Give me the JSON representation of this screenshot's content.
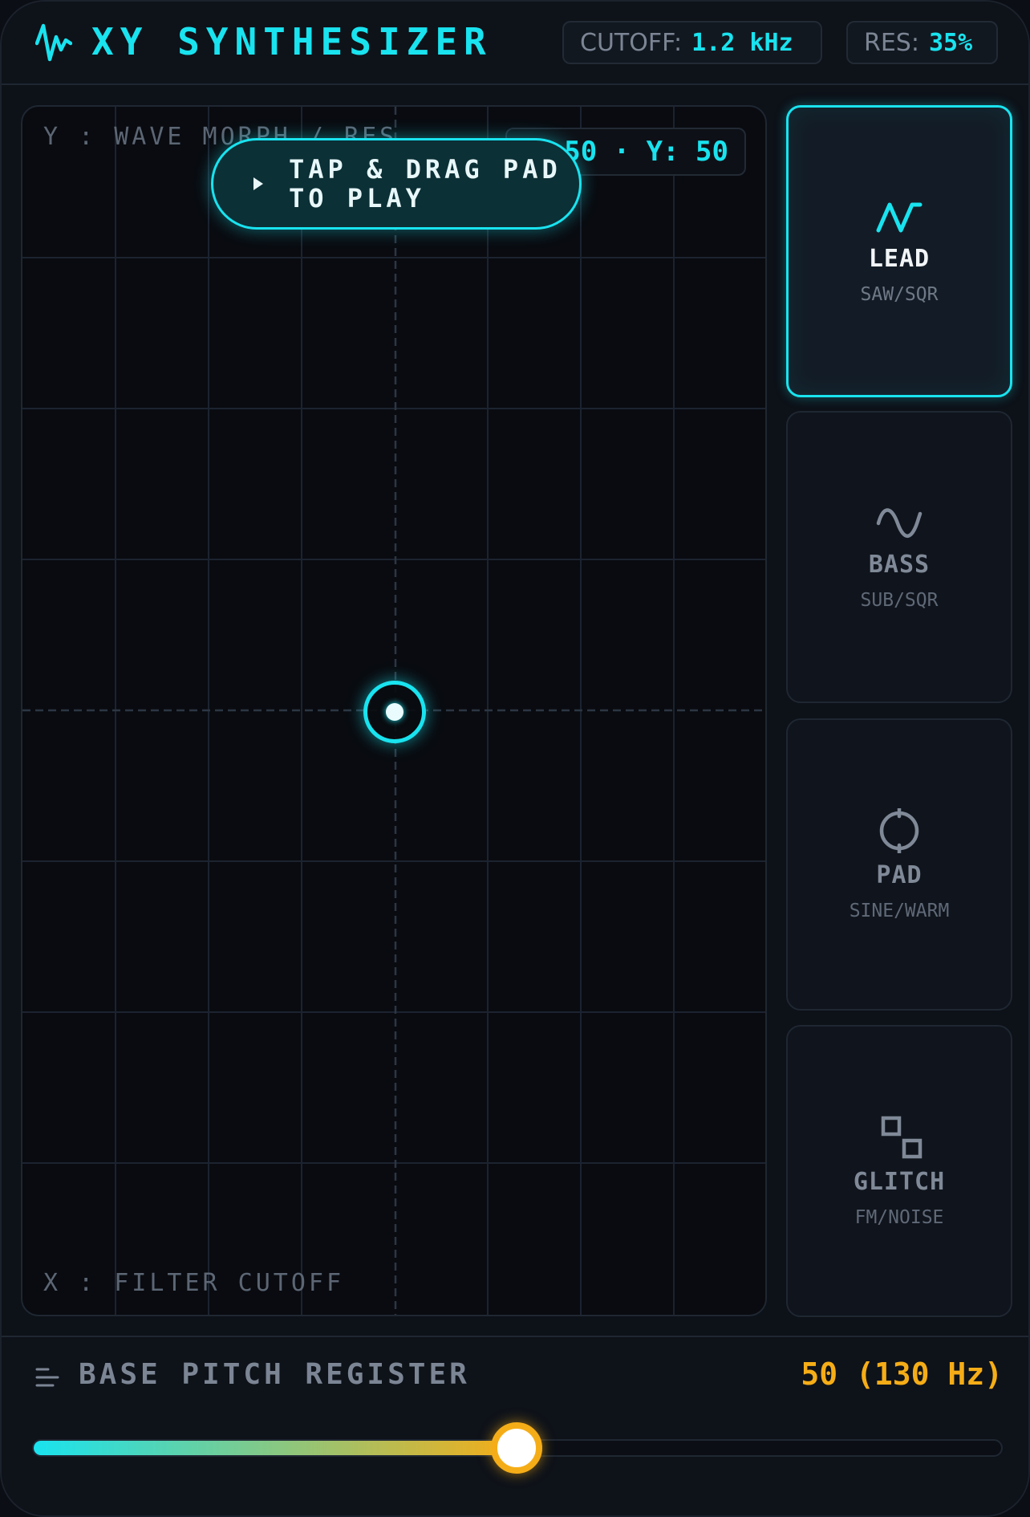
{
  "header": {
    "title": "XY SYNTHESIZER",
    "cutoff_label": "CUTOFF:",
    "cutoff_value": "1.2 kHz",
    "res_label": "RES:",
    "res_value": "35%"
  },
  "pad": {
    "y_axis_label": "Y : WAVE MORPH / RES",
    "x_axis_label": "X : FILTER CUTOFF",
    "coord_readout": "X: 50 · Y: 50",
    "x_value": 50,
    "y_value": 50,
    "hint": "TAP & DRAG PAD TO PLAY"
  },
  "presets": [
    {
      "name": "LEAD",
      "sub": "SAW/SQR",
      "icon": "zigzag-wave-icon",
      "active": true
    },
    {
      "name": "BASS",
      "sub": "SUB/SQR",
      "icon": "sine-wave-icon",
      "active": false
    },
    {
      "name": "PAD",
      "sub": "SINE/WARM",
      "icon": "circle-pulse-icon",
      "active": false
    },
    {
      "name": "GLITCH",
      "sub": "FM/NOISE",
      "icon": "squares-icon",
      "active": false
    }
  ],
  "pitch": {
    "label": "BASE PITCH REGISTER",
    "value_text": "50 (130 Hz)",
    "value": 50,
    "max": 100
  },
  "colors": {
    "accent": "#19e3ef",
    "pitch": "#f5ad17",
    "background": "#0d1118"
  }
}
